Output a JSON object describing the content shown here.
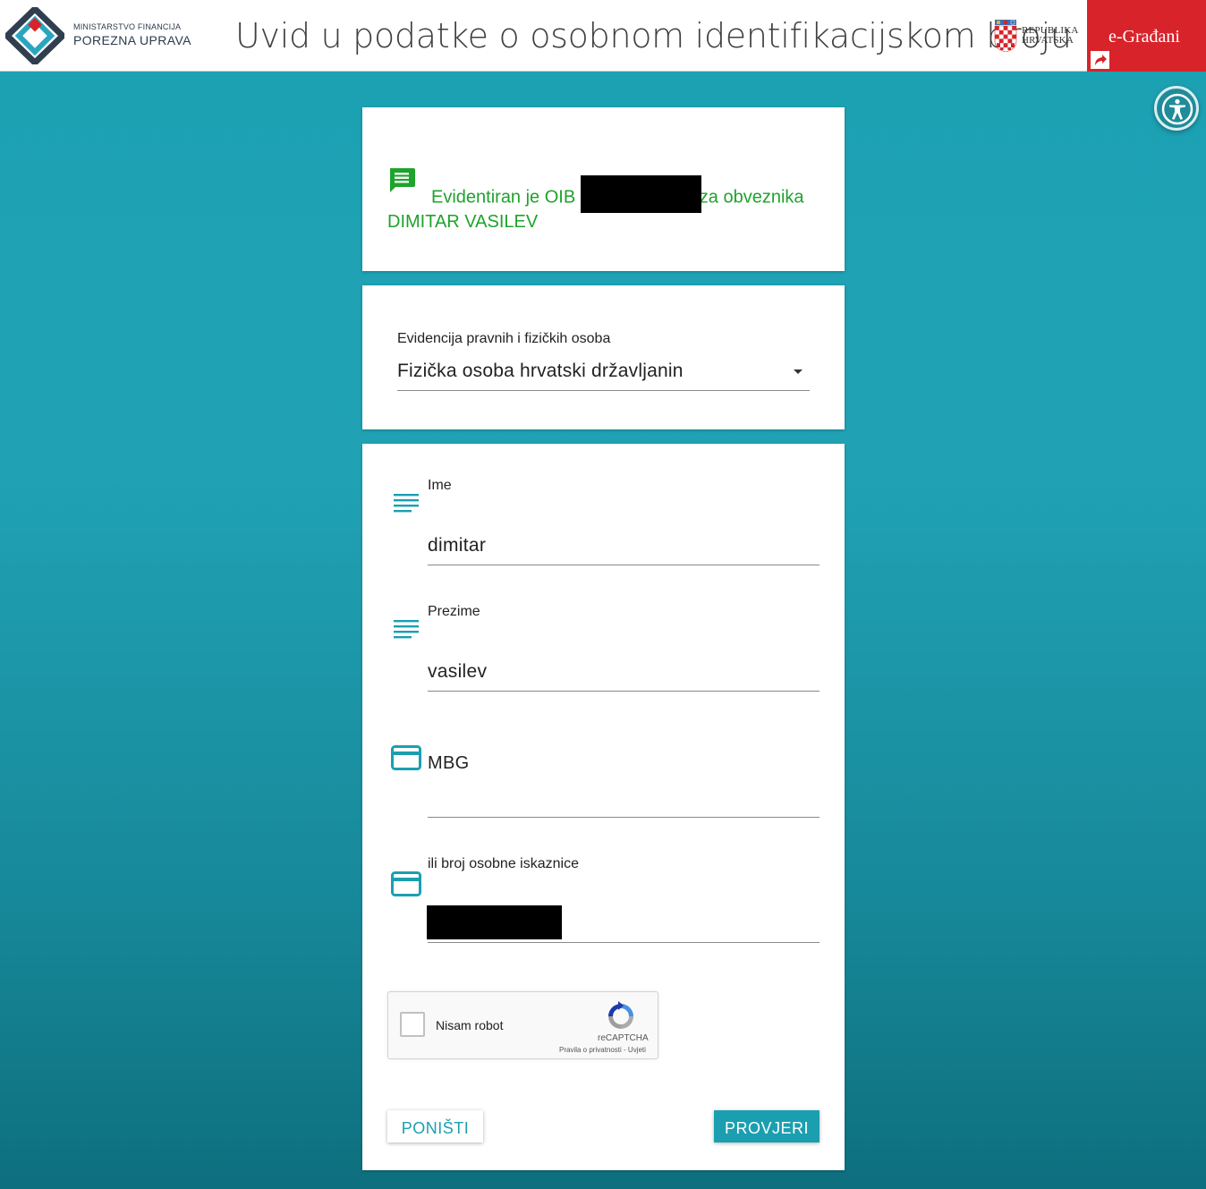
{
  "header": {
    "ministry_small": "MINISTARSTVO FINANCIJA",
    "ministry_big": "POREZNA UPRAVA",
    "title": "Uvid u podatke o osobnom identifikacijskom broju",
    "republic_line1": "REPUBLIKA",
    "republic_line2": "HRVATSKA",
    "egradani": "e-Građani"
  },
  "message": {
    "part1": "Evidentiran je OIB",
    "part2": "za obveznika",
    "line2": "DIMITAR VASILEV",
    "color": "#1ea32c"
  },
  "registry": {
    "label": "Evidencija pravnih i fizičkih osoba",
    "value": "Fizička osoba hrvatski državljanin"
  },
  "form": {
    "first_name_label": "Ime",
    "first_name_value": "dimitar",
    "last_name_label": "Prezime",
    "last_name_value": "vasilev",
    "mbg_label": "MBG",
    "mbg_value": "",
    "id_card_label": "ili broj osobne iskaznice"
  },
  "captcha": {
    "label": "Nisam robot",
    "brand": "reCAPTCHA",
    "links": "Pravila o privatnosti - Uvjeti"
  },
  "buttons": {
    "reset": "PONIŠTI",
    "submit": "PROVJERI"
  },
  "colors": {
    "accent": "#1b9fb0",
    "brand_red": "#d8232a"
  }
}
